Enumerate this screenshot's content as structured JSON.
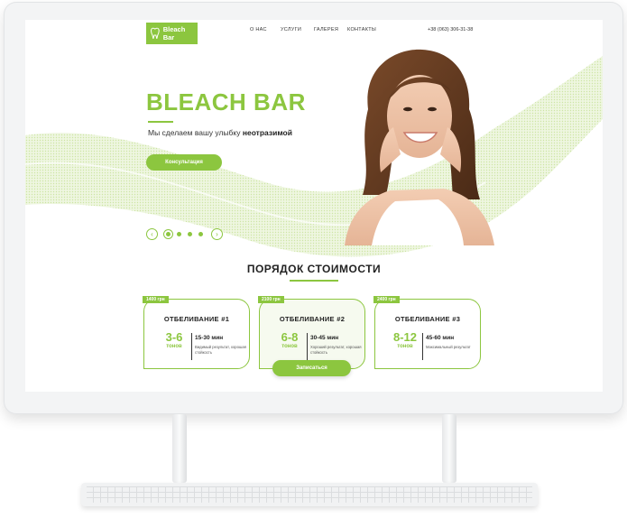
{
  "brand": {
    "logo_text": "Bleach Bar",
    "accent": "#8cc63f"
  },
  "nav": {
    "items": [
      "О НАС",
      "УСЛУГИ",
      "ГАЛЕРЕЯ",
      "КОНТАКТЫ"
    ]
  },
  "phone": "+38 (063) 306-31-38",
  "hero": {
    "title": "BLEACH BAR",
    "subtitle_plain": "Мы сделаем вашу улыбку ",
    "subtitle_bold": "неотразимой",
    "button": "Консультация"
  },
  "slider": {
    "prev_icon": "‹",
    "next_icon": "›",
    "dots": 4,
    "active_index": 0
  },
  "pricing": {
    "title": "ПОРЯДОК СТОИМОСТИ",
    "cards": [
      {
        "price": "1400 грн",
        "title": "ОТБЕЛИВАНИЕ #1",
        "tones": "3-6",
        "tones_unit": "тонов",
        "time": "15-30 мин",
        "desc": "Видимый результат, хорошая стойкость"
      },
      {
        "price": "2100 грн",
        "title": "ОТБЕЛИВАНИЕ #2",
        "tones": "6-8",
        "tones_unit": "тонов",
        "time": "30-45 мин",
        "desc": "Хороший результат, хорошая стойкость"
      },
      {
        "price": "2400 грн",
        "title": "ОТБЕЛИВАНИЕ #3",
        "tones": "8-12",
        "tones_unit": "тонов",
        "time": "45-60 мин",
        "desc": "Максимальный результат"
      }
    ],
    "book_button": "Записаться"
  }
}
